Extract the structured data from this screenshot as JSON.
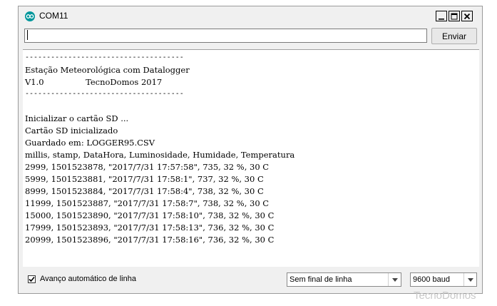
{
  "window": {
    "title": "COM11"
  },
  "send": {
    "input_value": "",
    "button_label": "Enviar"
  },
  "console": {
    "lines": [
      "-------------------------------------",
      "Estação Meteorológica com Datalogger",
      "V1.0                TecnoDomos 2017",
      "-------------------------------------",
      "",
      "Inicializar o cartão SD ...",
      "Cartão SD inicializado",
      "Guardado em: LOGGER95.CSV",
      "millis, stamp, DataHora, Luminosidade, Humidade, Temperatura",
      "2999, 1501523878, \"2017/7/31 17:57:58\", 735, 32 %, 30 C",
      "5999, 1501523881, \"2017/7/31 17:58:1\", 737, 32 %, 30 C",
      "8999, 1501523884, \"2017/7/31 17:58:4\", 738, 32 %, 30 C",
      "11999, 1501523887, \"2017/7/31 17:58:7\", 738, 32 %, 30 C",
      "15000, 1501523890, \"2017/7/31 17:58:10\", 738, 32 %, 30 C",
      "17999, 1501523893, \"2017/7/31 17:58:13\", 736, 32 %, 30 C",
      "20999, 1501523896, \"2017/7/31 17:58:16\", 736, 32 %, 30 C"
    ]
  },
  "footer": {
    "autoscroll_label": "Avanço automático de linha",
    "autoscroll_checked": true,
    "line_ending_value": "Sem final de linha",
    "baud_value": "9600 baud"
  },
  "watermark": "TecnoDomos",
  "colors": {
    "arduino_teal": "#00979c"
  }
}
